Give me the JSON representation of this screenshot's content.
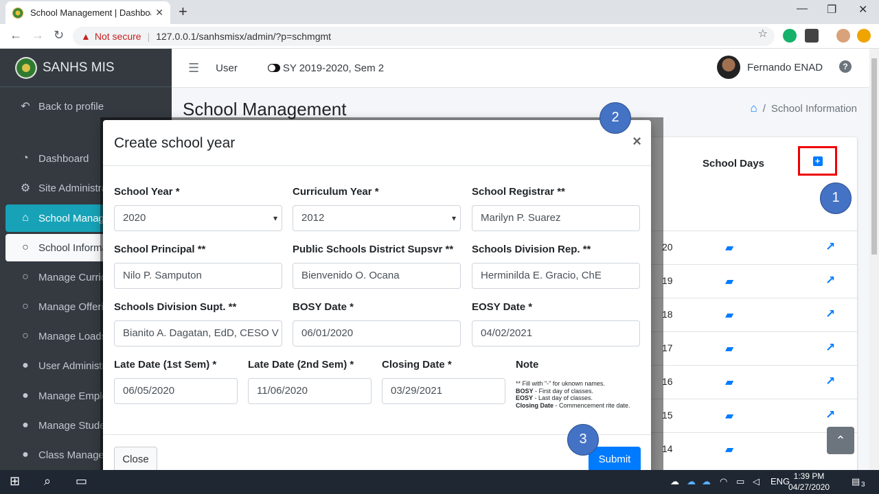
{
  "browser": {
    "tab_title": "School Management | Dashboard",
    "tab_close": "✕",
    "new_tab": "+",
    "minimize": "—",
    "restore": "❐",
    "close": "✕",
    "not_secure": "Not secure",
    "url": "127.0.0.1/sanhsmisx/admin/?p=schmgmt"
  },
  "sidebar": {
    "brand": "SANHS MIS",
    "back_to_profile": "Back to profile",
    "items": [
      {
        "label": "Dashboard",
        "icon": "tachometer-icon"
      },
      {
        "label": "Site Administration",
        "icon": "cogs-icon"
      },
      {
        "label": "School Management",
        "icon": "school-icon"
      },
      {
        "label": "School Information",
        "icon": "circle-icon"
      },
      {
        "label": "Manage Curriculum",
        "icon": "circle-icon"
      },
      {
        "label": "Manage Offerings",
        "icon": "circle-icon"
      },
      {
        "label": "Manage Loads",
        "icon": "circle-icon"
      },
      {
        "label": "User Administration",
        "icon": "user-icon"
      },
      {
        "label": "Manage Employees",
        "icon": "user-icon"
      },
      {
        "label": "Manage Students",
        "icon": "graduate-icon"
      },
      {
        "label": "Class Management",
        "icon": "user-icon"
      }
    ]
  },
  "topnav": {
    "user_menu": "User",
    "school_year": "SY 2019-2020, Sem 2",
    "user_name": "Fernando ENAD",
    "help": "?"
  },
  "page": {
    "title": "School Management",
    "breadcrumb": "School Information",
    "school_days_header": "School Days",
    "add_icon": "+",
    "rows": [
      "20",
      "19",
      "18",
      "17",
      "16",
      "15",
      "14"
    ]
  },
  "modal": {
    "title": "Create school year",
    "close_icon": "×",
    "fields": {
      "school_year": {
        "label": "School Year *",
        "value": "2020"
      },
      "curriculum_year": {
        "label": "Curriculum Year *",
        "value": "2012"
      },
      "registrar": {
        "label": "School Registrar **",
        "value": "Marilyn P. Suarez"
      },
      "principal": {
        "label": "School Principal **",
        "value": "Nilo P. Samputon"
      },
      "district_supervisor": {
        "label": "Public Schools District Supsvr **",
        "value": "Bienvenido O. Ocana"
      },
      "division_rep": {
        "label": "Schools Division Rep. **",
        "value": "Herminilda E. Gracio, ChE"
      },
      "division_supt": {
        "label": "Schools Division Supt. **",
        "value": "Bianito A. Dagatan, EdD, CESO V"
      },
      "bosy": {
        "label": "BOSY Date *",
        "value": "06/01/2020"
      },
      "eosy": {
        "label": "EOSY Date *",
        "value": "04/02/2021"
      },
      "late_1st": {
        "label": "Late Date (1st Sem) *",
        "value": "06/05/2020"
      },
      "late_2nd": {
        "label": "Late Date (2nd Sem) *",
        "value": "11/06/2020"
      },
      "closing": {
        "label": "Closing Date *",
        "value": "03/29/2021"
      }
    },
    "note": {
      "label": "Note",
      "line1": "** Fill with \"-\" for uknown names.",
      "line2_key": "BOSY",
      "line2": " - First day of classes.",
      "line3_key": "EOSY",
      "line3": " - Last day of classes.",
      "line4_key": "Closing Date",
      "line4": " - Commencement rite date."
    },
    "close_button": "Close",
    "submit_button": "Submit"
  },
  "markers": [
    "1",
    "2",
    "3"
  ],
  "taskbar": {
    "language": "ENG",
    "time": "1:39 PM",
    "date": "04/27/2020",
    "notifications": "3"
  }
}
